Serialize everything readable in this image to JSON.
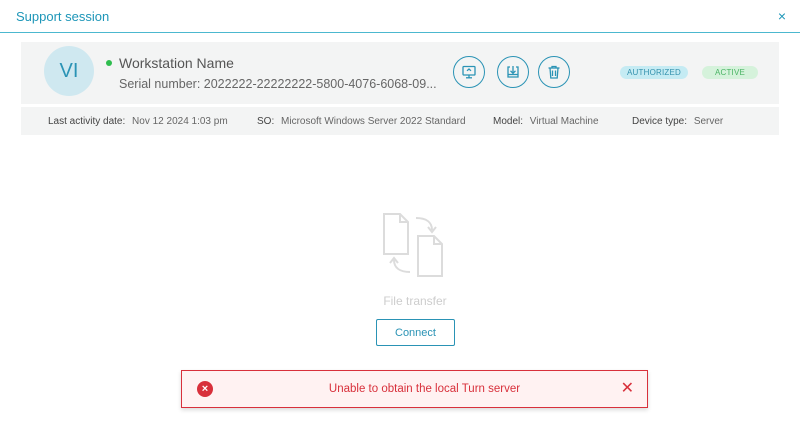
{
  "modal": {
    "title": "Support session",
    "close_glyph": "×"
  },
  "device": {
    "avatar_initials": "VI",
    "name": "Workstation Name",
    "serial_label": "Serial number:",
    "serial_value": "2022222-22222222-5800-4076-6068-09...",
    "status_dot_color": "#2ebd4e",
    "actions": [
      {
        "name": "remote-desktop",
        "icon": "monitor-icon"
      },
      {
        "name": "file-transfer",
        "icon": "download-tray-icon"
      },
      {
        "name": "delete",
        "icon": "trash-icon"
      }
    ],
    "badges": {
      "authorized": "AUTHORIZED",
      "active": "ACTIVE"
    }
  },
  "info": {
    "last_activity_label": "Last activity date:",
    "last_activity_value": "Nov 12 2024 1:03 pm",
    "so_label": "SO:",
    "so_value": "Microsoft Windows Server 2022 Standard",
    "model_label": "Model:",
    "model_value": "Virtual Machine",
    "device_type_label": "Device type:",
    "device_type_value": "Server"
  },
  "file_transfer": {
    "icon": "file-transfer-icon",
    "label": "File transfer",
    "connect_label": "Connect"
  },
  "alert": {
    "icon_glyph": "×",
    "message": "Unable to obtain the local Turn server",
    "close_glyph": "✕",
    "color": "#d8303b"
  },
  "colors": {
    "accent": "#2a93b5",
    "authorized_bg": "#c5ebf3",
    "active_bg": "#d5f2db"
  }
}
